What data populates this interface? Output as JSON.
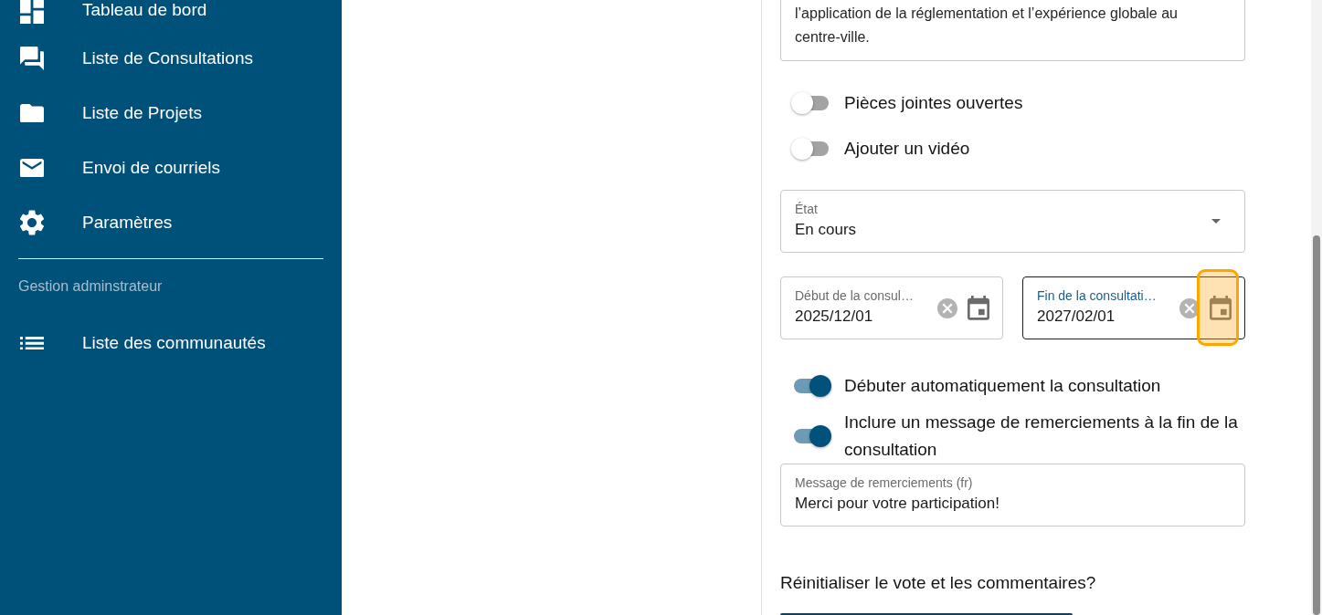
{
  "sidebar": {
    "items": [
      {
        "label": "Tableau de bord"
      },
      {
        "label": "Liste de Consultations"
      },
      {
        "label": "Liste de Projets"
      },
      {
        "label": "Envoi de courriels"
      },
      {
        "label": "Paramètres"
      }
    ],
    "admin_section": {
      "heading": "Gestion adminstrateur",
      "items": [
        {
          "label": "Liste des communautés"
        }
      ]
    }
  },
  "form": {
    "fields": [
      {
        "kind": "textarea",
        "value": "l’application de la réglementation et l’expérience globale au centre-ville."
      },
      {
        "kind": "toggle",
        "label": "Pièces jointes ouvertes",
        "on": false
      },
      {
        "kind": "toggle",
        "label": "Ajouter un vidéo",
        "on": false
      },
      {
        "kind": "select",
        "label": "État",
        "value": "En cours"
      },
      {
        "kind": "date_range",
        "dates": [
          {
            "label": "Début de la consul…",
            "value": "2025/12/01",
            "focused": false,
            "highlighted": false
          },
          {
            "label": "Fin de la consultati…",
            "value": "2027/02/01",
            "focused": true,
            "highlighted": true
          }
        ]
      },
      {
        "kind": "toggle",
        "label": "Débuter automatiquement la consultation",
        "on": true
      },
      {
        "kind": "toggle",
        "label": "Inclure un message de remerciements à la fin de la consultation",
        "on": true
      },
      {
        "kind": "text_field",
        "label": "Message de remerciements (fr)",
        "value": "Merci pour votre participation!"
      },
      {
        "kind": "question",
        "text": "Réinitialiser le vote et les commentaires?"
      },
      {
        "kind": "button"
      }
    ]
  }
}
